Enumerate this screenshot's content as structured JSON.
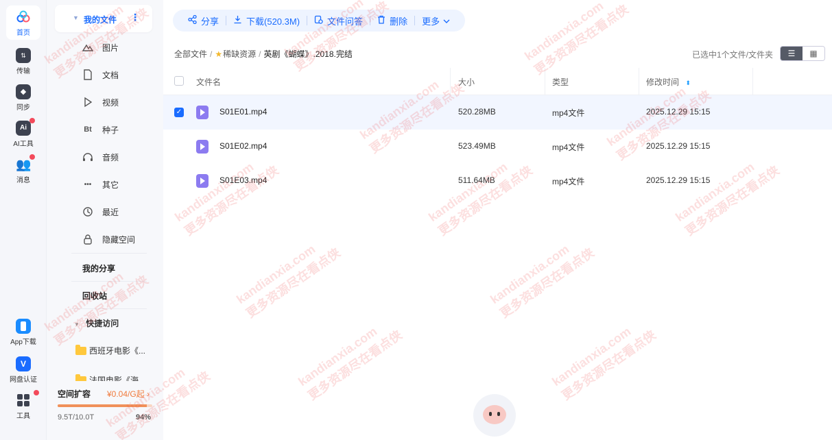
{
  "rail": {
    "home": "首页",
    "transfer": "传输",
    "sync": "同步",
    "ai": "AI工具",
    "message": "消息",
    "app": "App下载",
    "auth": "网盘认证",
    "tools": "工具",
    "icons": {
      "home": "cloud-logo-icon",
      "transfer": "transfer-icon",
      "sync": "sync-icon",
      "ai": "ai-icon",
      "message": "message-icon",
      "app": "phone-icon",
      "auth": "verify-icon",
      "tools": "grid-icon"
    }
  },
  "sidebar": {
    "my_files": "我的文件",
    "categories": [
      {
        "label": "图片",
        "icon": "image-icon",
        "glyph": "⛰"
      },
      {
        "label": "文档",
        "icon": "document-icon",
        "glyph": "▢"
      },
      {
        "label": "视频",
        "icon": "video-icon",
        "glyph": "▷"
      },
      {
        "label": "种子",
        "icon": "torrent-icon",
        "glyph": "Bt"
      },
      {
        "label": "音频",
        "icon": "audio-icon",
        "glyph": "♫"
      },
      {
        "label": "其它",
        "icon": "other-icon",
        "glyph": "•••"
      },
      {
        "label": "最近",
        "icon": "recent-icon",
        "glyph": "◷"
      },
      {
        "label": "隐藏空间",
        "icon": "lock-icon",
        "glyph": "🔒"
      }
    ],
    "my_share": "我的分享",
    "recycle": "回收站",
    "quick_access": "快捷访问",
    "quick_items": [
      "西班牙电影《...",
      "法国电影《海..."
    ],
    "space": {
      "title": "空间扩容",
      "price": "¥0.04/G起",
      "chevron": "›",
      "used": "9.5T/10.0T",
      "percent": "94%",
      "percent_value": 0.94
    }
  },
  "toolbar": {
    "share": "分享",
    "download": "下载(520.3M)",
    "qa": "文件问答",
    "delete": "删除",
    "more": "更多"
  },
  "breadcrumb": {
    "root": "全部文件",
    "level1": "稀缺资源",
    "current": "英剧《蝴蝶》.2018.完结",
    "separator": "/"
  },
  "selection_info": "已选中1个文件/文件夹",
  "table": {
    "headers": {
      "name": "文件名",
      "size": "大小",
      "type": "类型",
      "modified": "修改时间"
    },
    "rows": [
      {
        "name": "S01E01.mp4",
        "size": "520.28MB",
        "type": "mp4文件",
        "modified": "2025.12.29 15:15",
        "selected": true
      },
      {
        "name": "S01E02.mp4",
        "size": "523.49MB",
        "type": "mp4文件",
        "modified": "2025.12.29 15:15",
        "selected": false
      },
      {
        "name": "S01E03.mp4",
        "size": "511.64MB",
        "type": "mp4文件",
        "modified": "2025.12.29 15:15",
        "selected": false
      }
    ]
  },
  "watermark": {
    "line1": "kandianxia.com",
    "line2": "更多资源尽在看点侠"
  },
  "colors": {
    "accent": "#1a6cff",
    "badge": "#f34a5b",
    "progress": "#f0915a"
  }
}
